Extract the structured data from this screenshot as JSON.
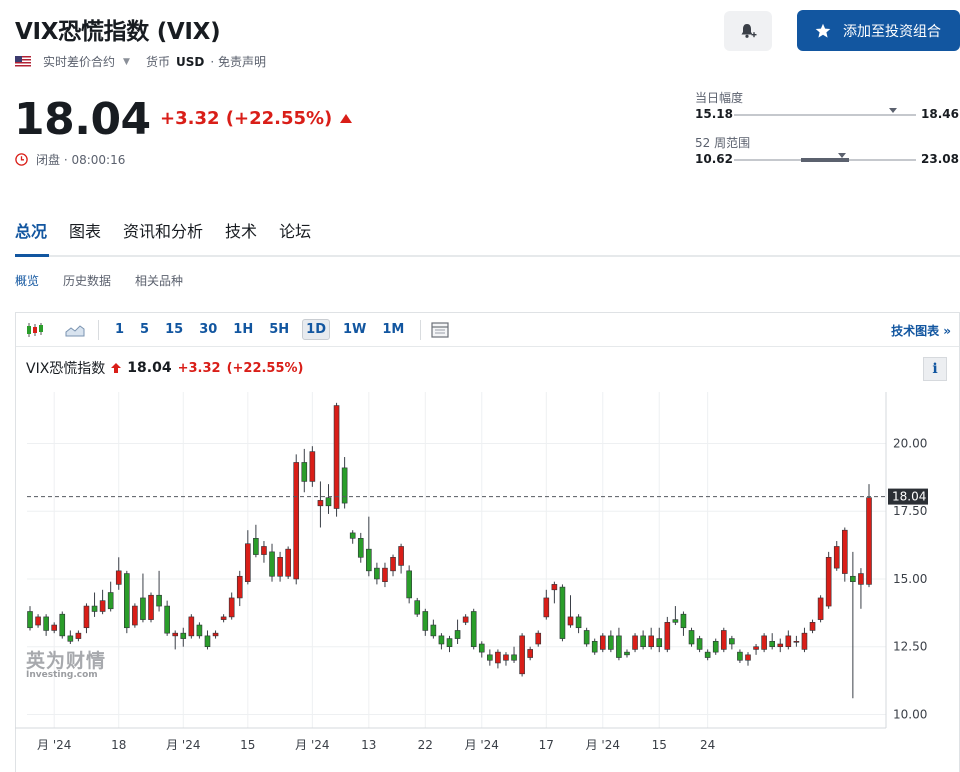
{
  "header": {
    "title": "VIX恐慌指数 (VIX)",
    "contract": "实时差价合约",
    "currency_label": "货币",
    "currency": "USD",
    "disclaimer": "· 免责声明",
    "add_button": "添加至投资组合"
  },
  "quote": {
    "price": "18.04",
    "change": "+3.32 (+22.55%)",
    "status": "闭盘 · 08:00:16"
  },
  "ranges": {
    "day_label": "当日幅度",
    "day_low": "15.18",
    "day_high": "18.46",
    "year_label": "52 周范围",
    "year_low": "10.62",
    "year_high": "23.08",
    "current": 18.04
  },
  "tabs": [
    "总况",
    "图表",
    "资讯和分析",
    "技术",
    "论坛"
  ],
  "subtabs": [
    "概览",
    "历史数据",
    "相关品种"
  ],
  "toolbar": {
    "intervals": [
      "1",
      "5",
      "15",
      "30",
      "1H",
      "5H",
      "1D",
      "1W",
      "1M"
    ],
    "selected": "1D",
    "tech_chart": "技术图表 »"
  },
  "legend": {
    "name": "VIX恐慌指数",
    "price": "18.04",
    "change": "+3.32",
    "change_pct": "(+22.55%)"
  },
  "info_label": "i",
  "watermark": {
    "cn": "英为财情",
    "en": "Investing.com"
  },
  "colors": {
    "up": "#d91e18",
    "down": "#2a9d2a",
    "accent": "#1256a0"
  },
  "chart_data": {
    "type": "candlestick",
    "title": "VIX恐慌指数",
    "y_ticks": [
      "10.00",
      "12.50",
      "15.00",
      "17.50",
      "20.00"
    ],
    "ylim": [
      9.5,
      21.9
    ],
    "last_price": "18.04",
    "last_value": 18.04,
    "x_ticks": [
      {
        "i": 3,
        "label": "月 '24"
      },
      {
        "i": 11,
        "label": "18"
      },
      {
        "i": 19,
        "label": "月 '24"
      },
      {
        "i": 27,
        "label": "15"
      },
      {
        "i": 35,
        "label": "月 '24"
      },
      {
        "i": 42,
        "label": "13"
      },
      {
        "i": 49,
        "label": "22"
      },
      {
        "i": 56,
        "label": "月 '24"
      },
      {
        "i": 64,
        "label": "17"
      },
      {
        "i": 71,
        "label": "月 '24"
      },
      {
        "i": 78,
        "label": "15"
      },
      {
        "i": 84,
        "label": "24"
      }
    ],
    "candles": [
      [
        13.8,
        13.2,
        14.0,
        13.1
      ],
      [
        13.3,
        13.6,
        13.7,
        13.2
      ],
      [
        13.6,
        13.1,
        13.7,
        12.9
      ],
      [
        13.1,
        13.3,
        13.4,
        13.0
      ],
      [
        13.7,
        12.9,
        13.8,
        12.8
      ],
      [
        12.9,
        12.7,
        13.1,
        12.6
      ],
      [
        12.8,
        13.0,
        13.1,
        12.7
      ],
      [
        13.2,
        14.0,
        14.1,
        13.0
      ],
      [
        14.0,
        13.8,
        14.5,
        13.6
      ],
      [
        13.8,
        14.2,
        14.6,
        13.7
      ],
      [
        14.5,
        13.9,
        14.9,
        13.8
      ],
      [
        14.8,
        15.3,
        15.8,
        14.6
      ],
      [
        15.2,
        13.2,
        15.3,
        13.0
      ],
      [
        13.3,
        14.0,
        14.1,
        13.2
      ],
      [
        14.3,
        13.5,
        15.2,
        13.4
      ],
      [
        13.5,
        14.4,
        14.5,
        13.4
      ],
      [
        14.4,
        14.0,
        15.3,
        13.8
      ],
      [
        14.0,
        13.0,
        14.2,
        12.9
      ],
      [
        12.9,
        13.0,
        13.1,
        12.4
      ],
      [
        13.0,
        12.8,
        13.2,
        12.5
      ],
      [
        12.9,
        13.6,
        13.7,
        12.8
      ],
      [
        13.3,
        12.9,
        13.4,
        12.8
      ],
      [
        12.9,
        12.5,
        13.1,
        12.4
      ],
      [
        12.9,
        13.0,
        13.1,
        12.8
      ],
      [
        13.5,
        13.6,
        13.7,
        13.4
      ],
      [
        13.6,
        14.3,
        14.5,
        13.5
      ],
      [
        14.3,
        15.1,
        15.3,
        14.0
      ],
      [
        14.9,
        16.3,
        16.8,
        14.8
      ],
      [
        16.5,
        15.9,
        17.0,
        15.8
      ],
      [
        15.9,
        16.2,
        16.4,
        15.6
      ],
      [
        16.0,
        15.1,
        16.3,
        14.9
      ],
      [
        15.1,
        15.8,
        16.0,
        14.9
      ],
      [
        15.1,
        16.1,
        16.2,
        15.0
      ],
      [
        15.0,
        19.3,
        19.6,
        14.8
      ],
      [
        19.3,
        18.6,
        19.8,
        18.2
      ],
      [
        18.6,
        19.7,
        19.9,
        18.4
      ],
      [
        17.7,
        17.9,
        18.6,
        16.9
      ],
      [
        18.0,
        17.7,
        18.5,
        17.4
      ],
      [
        17.6,
        21.4,
        21.5,
        17.3
      ],
      [
        19.1,
        17.8,
        19.5,
        17.6
      ],
      [
        16.7,
        16.5,
        16.8,
        16.3
      ],
      [
        16.5,
        15.8,
        16.7,
        15.6
      ],
      [
        16.1,
        15.3,
        17.3,
        15.1
      ],
      [
        15.4,
        15.0,
        15.6,
        14.8
      ],
      [
        14.9,
        15.4,
        15.6,
        14.7
      ],
      [
        15.3,
        15.8,
        15.9,
        15.1
      ],
      [
        15.5,
        16.2,
        16.3,
        15.2
      ],
      [
        15.3,
        14.3,
        15.5,
        14.1
      ],
      [
        14.2,
        13.7,
        14.3,
        13.6
      ],
      [
        13.8,
        13.1,
        13.9,
        12.9
      ],
      [
        13.3,
        12.9,
        13.5,
        12.8
      ],
      [
        12.9,
        12.6,
        13.0,
        12.4
      ],
      [
        12.8,
        12.5,
        12.9,
        12.3
      ],
      [
        13.1,
        12.8,
        13.5,
        12.6
      ],
      [
        13.4,
        13.6,
        13.7,
        13.3
      ],
      [
        13.8,
        12.5,
        13.9,
        12.4
      ],
      [
        12.6,
        12.3,
        12.7,
        12.1
      ],
      [
        12.2,
        12.0,
        12.4,
        11.8
      ],
      [
        11.9,
        12.3,
        12.4,
        11.7
      ],
      [
        12.0,
        12.2,
        12.3,
        11.8
      ],
      [
        12.2,
        12.0,
        12.5,
        11.9
      ],
      [
        11.5,
        12.9,
        13.0,
        11.4
      ],
      [
        12.1,
        12.4,
        12.5,
        12.0
      ],
      [
        12.6,
        13.0,
        13.1,
        12.5
      ],
      [
        13.6,
        14.3,
        14.6,
        13.5
      ],
      [
        14.6,
        14.8,
        14.9,
        14.1
      ],
      [
        14.7,
        12.8,
        14.8,
        12.7
      ],
      [
        13.3,
        13.6,
        14.4,
        13.2
      ],
      [
        13.6,
        13.2,
        13.7,
        13.0
      ],
      [
        13.1,
        12.6,
        13.2,
        12.5
      ],
      [
        12.7,
        12.3,
        12.8,
        12.2
      ],
      [
        12.4,
        12.9,
        13.0,
        12.3
      ],
      [
        12.9,
        12.4,
        13.1,
        12.3
      ],
      [
        12.9,
        12.1,
        13.2,
        12.0
      ],
      [
        12.3,
        12.2,
        12.4,
        12.1
      ],
      [
        12.4,
        12.9,
        13.0,
        12.3
      ],
      [
        12.9,
        12.5,
        13.1,
        12.4
      ],
      [
        12.5,
        12.9,
        13.2,
        12.4
      ],
      [
        12.8,
        12.5,
        13.2,
        12.3
      ],
      [
        12.4,
        13.4,
        13.6,
        12.3
      ],
      [
        13.5,
        13.4,
        14.0,
        13.3
      ],
      [
        13.7,
        13.2,
        13.8,
        12.9
      ],
      [
        13.1,
        12.6,
        13.2,
        12.5
      ],
      [
        12.8,
        12.4,
        12.9,
        12.3
      ],
      [
        12.3,
        12.1,
        12.4,
        12.0
      ],
      [
        12.7,
        12.3,
        12.8,
        12.2
      ],
      [
        12.4,
        13.1,
        13.2,
        12.3
      ],
      [
        12.8,
        12.6,
        12.9,
        12.4
      ],
      [
        12.3,
        12.0,
        12.4,
        11.9
      ],
      [
        12.0,
        12.2,
        12.3,
        11.8
      ],
      [
        12.4,
        12.5,
        12.6,
        12.2
      ],
      [
        12.4,
        12.9,
        13.0,
        12.3
      ],
      [
        12.7,
        12.5,
        13.0,
        12.4
      ],
      [
        12.5,
        12.6,
        12.8,
        12.3
      ],
      [
        12.5,
        12.9,
        13.1,
        12.4
      ],
      [
        12.7,
        12.7,
        12.9,
        12.5
      ],
      [
        12.4,
        13.0,
        13.2,
        12.3
      ],
      [
        13.1,
        13.4,
        13.5,
        13.0
      ],
      [
        13.5,
        14.3,
        14.4,
        13.4
      ],
      [
        14.0,
        15.8,
        16.0,
        13.9
      ],
      [
        15.4,
        16.2,
        16.4,
        15.3
      ],
      [
        15.2,
        16.8,
        16.9,
        14.9
      ],
      [
        15.1,
        14.9,
        16.0,
        10.6
      ],
      [
        14.8,
        15.2,
        15.4,
        13.9
      ],
      [
        14.8,
        18.0,
        18.5,
        14.7
      ]
    ]
  }
}
